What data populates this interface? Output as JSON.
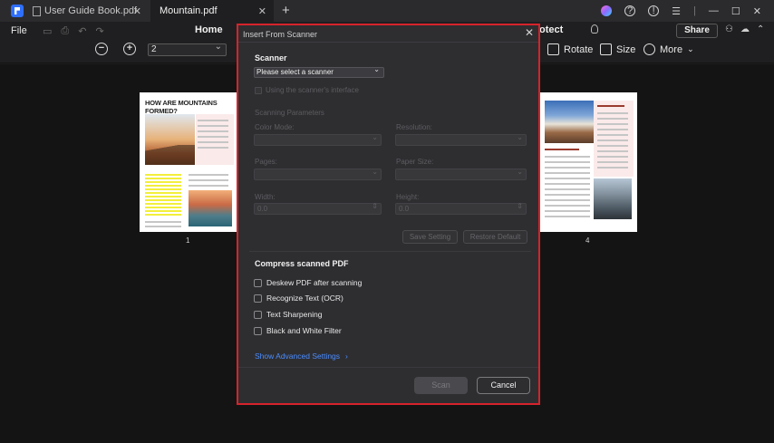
{
  "tabs": [
    {
      "label": "User Guide Book.pdf"
    },
    {
      "label": "Mountain.pdf"
    }
  ],
  "menu": {
    "file": "File",
    "home": "Home",
    "protect": "otect",
    "share": "Share"
  },
  "toolbar": {
    "page_value": "2",
    "rotate": "Rotate",
    "size": "Size",
    "more": "More"
  },
  "pages": {
    "page1_title": "HOW ARE MOUNTAINS FORMED?",
    "page1_number": "1",
    "page4_number": "4"
  },
  "dialog": {
    "title": "Insert From Scanner",
    "scanner_section": "Scanner",
    "scanner_placeholder": "Please select a scanner",
    "use_interface": "Using the scanner's interface",
    "scanning_parameters": "Scanning Parameters",
    "color_mode": "Color Mode:",
    "resolution": "Resolution:",
    "pages": "Pages:",
    "paper_size": "Paper Size:",
    "width": "Width:",
    "height": "Height:",
    "width_value": "0.0",
    "height_value": "0.0",
    "save_setting": "Save Setting",
    "restore_default": "Restore Default",
    "compress_section": "Compress scanned PDF",
    "options": [
      "Deskew PDF after scanning",
      "Recognize Text (OCR)",
      "Text Sharpening",
      "Black and White Filter"
    ],
    "advanced": "Show Advanced Settings",
    "scan": "Scan",
    "cancel": "Cancel"
  },
  "colors": {
    "highlight_border": "#d6232b",
    "link": "#4a8cff",
    "app_blue": "#2f6fff"
  }
}
